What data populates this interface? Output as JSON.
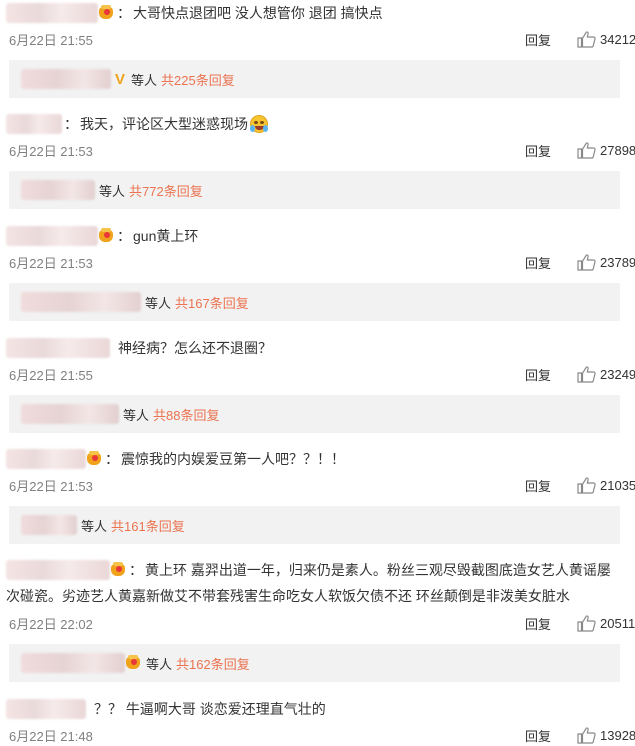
{
  "comments": [
    {
      "text": "大哥快点退团吧 没人想管你 退团 搞快点",
      "date": "6月22日 21:55",
      "reply_label": "回复",
      "likes": "34212",
      "thread": {
        "deng": "等人",
        "total": "共225条回复"
      }
    },
    {
      "text": "我天，评论区大型迷惑现场",
      "date": "6月22日 21:53",
      "reply_label": "回复",
      "likes": "27898",
      "thread": {
        "deng": "等人",
        "total": "共772条回复"
      }
    },
    {
      "text": "gun黄上环",
      "date": "6月22日 21:53",
      "reply_label": "回复",
      "likes": "23789",
      "thread": {
        "deng": "等人",
        "total": "共167条回复"
      }
    },
    {
      "text": "神经病？怎么还不退圈？",
      "date": "6月22日 21:55",
      "reply_label": "回复",
      "likes": "23249",
      "thread": {
        "deng": "等人",
        "total": "共88条回复"
      }
    },
    {
      "text": "震惊我的内娱爱豆第一人吧？？！！",
      "date": "6月22日 21:53",
      "reply_label": "回复",
      "likes": "21035",
      "thread": {
        "deng": "等人",
        "total": "共161条回复"
      }
    },
    {
      "text": "黄上环 嘉羿出道一年，归来仍是素人。粉丝三观尽毁截图底造女艺人黄谣屡",
      "text2": "次碰瓷。劣迹艺人黄嘉新做艾不带套残害生命吃女人软饭欠债不还 环丝颠倒是非泼美女脏水",
      "date": "6月22日 22:02",
      "reply_label": "回复",
      "likes": "20511",
      "thread": {
        "deng": "等人",
        "total": "共162条回复"
      }
    },
    {
      "text": "？？ 牛逼啊大哥 谈恋爱还理直气壮的",
      "date": "6月22日 21:48",
      "reply_label": "回复",
      "likes": "13928"
    }
  ],
  "colors": {
    "link": "#eb7350",
    "muted": "#808080",
    "reply_bg": "#f2f2f2"
  },
  "icons": {
    "like": "thumbs-up-icon",
    "vip": "crown-badge-icon",
    "verified": "v-icon"
  }
}
